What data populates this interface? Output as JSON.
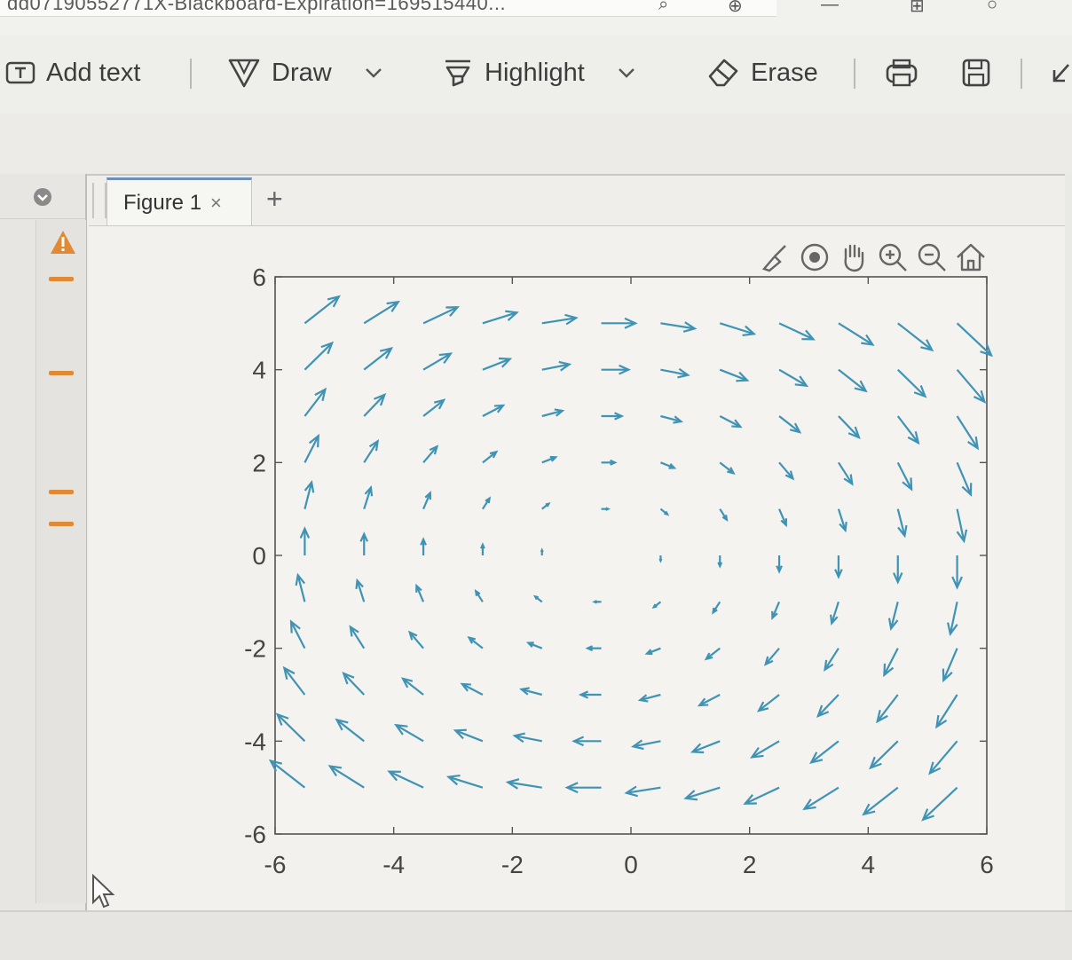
{
  "browser": {
    "url_fragment": "dd07190552771X-Blackboard-Expiration=169515440...",
    "controls": [
      "search-icon",
      "new-tab-icon",
      "minimize-icon",
      "add-icon",
      "circle-icon"
    ]
  },
  "toolbar": {
    "add_text_label": "Add text",
    "draw_label": "Draw",
    "highlight_label": "Highlight",
    "erase_label": "Erase",
    "icons": [
      "text-box-icon",
      "draw-pen-icon",
      "chevron-down-icon",
      "highlighter-icon",
      "chevron-down-icon",
      "eraser-icon",
      "print-icon",
      "save-icon",
      "expand-icon"
    ]
  },
  "sidebar": {
    "markers": [
      "warning-icon",
      "issue-mark",
      "issue-mark",
      "issue-mark",
      "issue-mark"
    ],
    "colors": {
      "warning": "#e18a35"
    }
  },
  "figure_tab": {
    "label": "Figure 1",
    "close_symbol": "×",
    "add_symbol": "+"
  },
  "axes_toolbar": [
    "brush-icon",
    "rotate-icon",
    "pan-hand-icon",
    "zoom-in-icon",
    "zoom-out-icon",
    "home-icon"
  ],
  "chart_data": {
    "type": "quiver",
    "title": "",
    "xlabel": "",
    "ylabel": "",
    "xlim": [
      -6,
      6
    ],
    "ylim": [
      -6,
      6
    ],
    "xticks": [
      -6,
      -4,
      -2,
      0,
      2,
      4,
      6
    ],
    "yticks": [
      -6,
      -4,
      -2,
      0,
      2,
      4,
      6
    ],
    "grid_x": [
      -5,
      -4,
      -3,
      -2,
      -1,
      0,
      1,
      2,
      3,
      4,
      5,
      6
    ],
    "grid_y": [
      -5,
      -4,
      -3,
      -2,
      -1,
      0,
      1,
      2,
      3,
      4,
      5
    ],
    "field": "F(x,y) = (y, -x) — clockwise rotation, arrow length proportional to distance from origin",
    "arrow_color": "#3f93b4",
    "grid": false
  }
}
